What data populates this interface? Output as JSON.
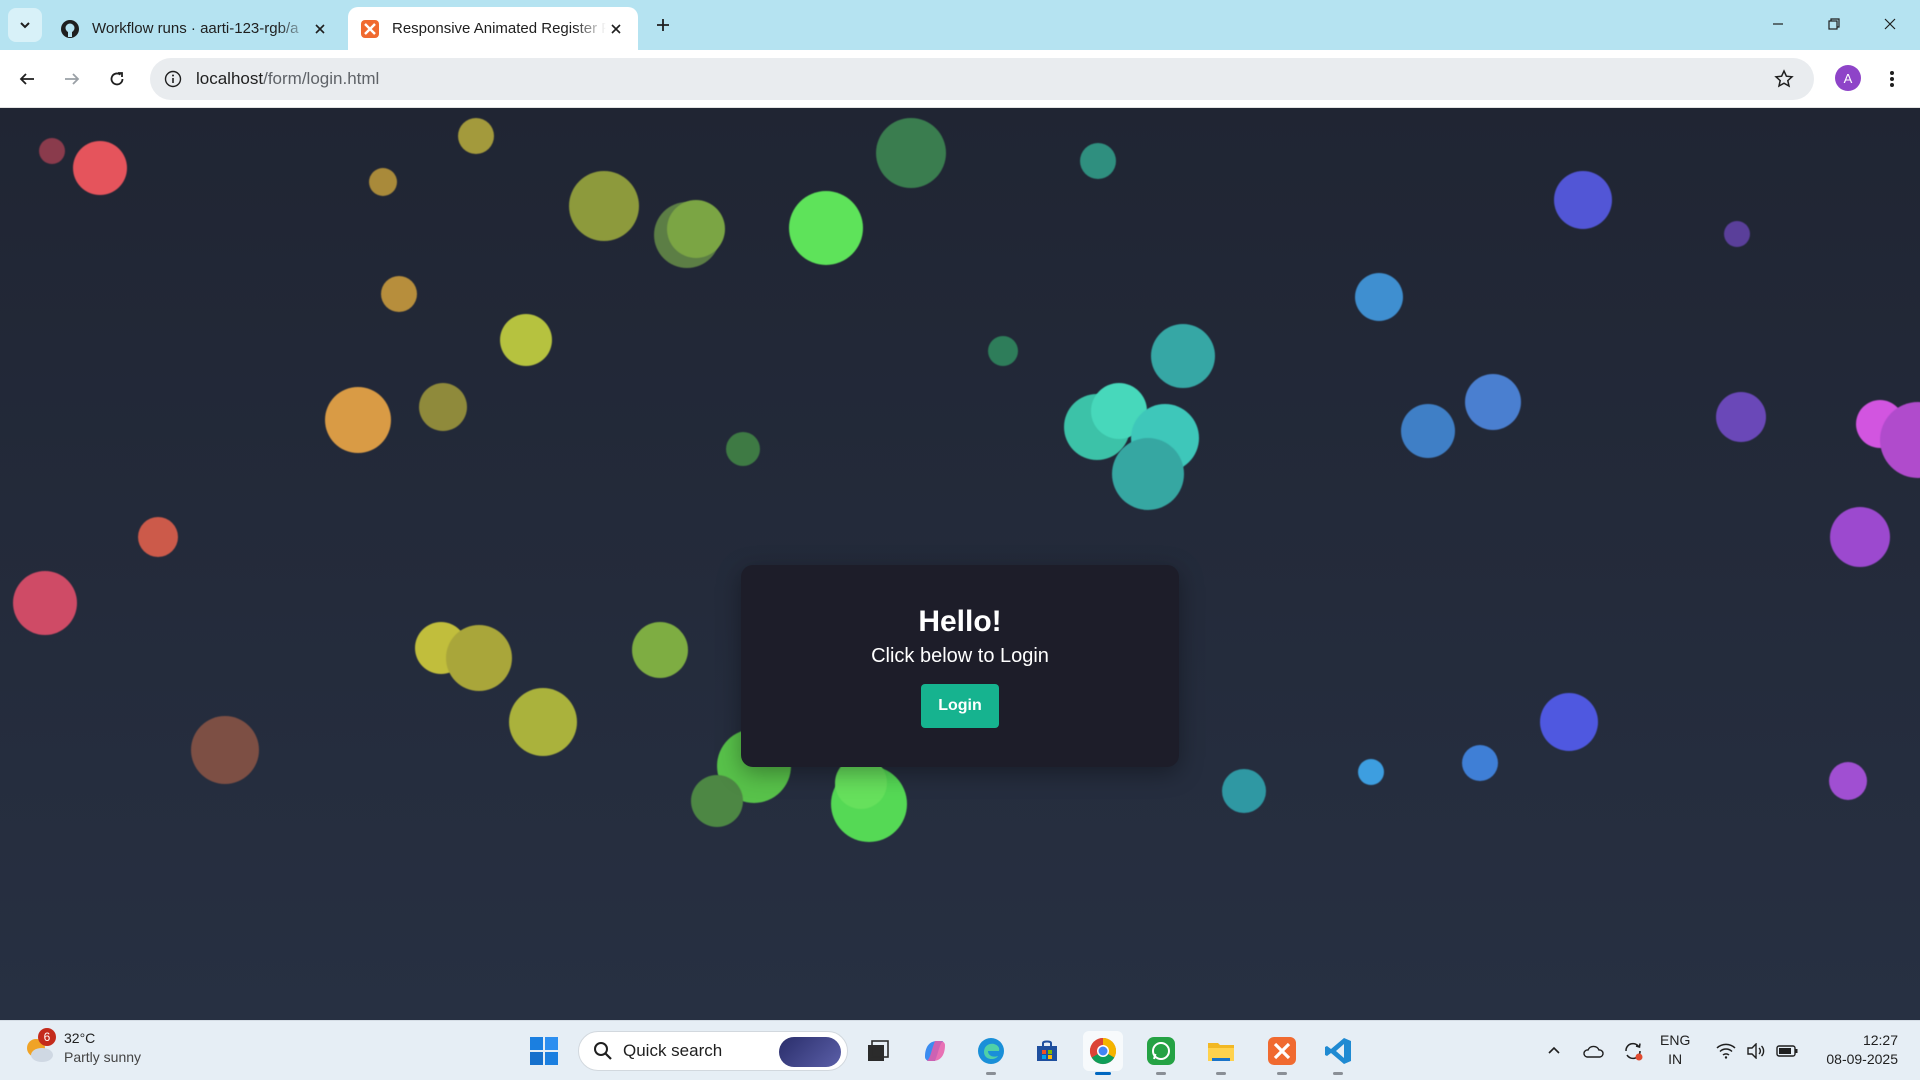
{
  "browser": {
    "tabs": [
      {
        "title": "Workflow runs · aarti-123-rgb/a",
        "icon": "github-icon",
        "active": false
      },
      {
        "title": "Responsive Animated Register F",
        "icon": "xampp-icon",
        "active": true
      }
    ],
    "url_host": "localhost",
    "url_path": "/form/login.html",
    "profile_initial": "A"
  },
  "page": {
    "heading": "Hello!",
    "subheading": "Click below to Login",
    "login_label": "Login",
    "accent_color": "#16b38f"
  },
  "taskbar": {
    "weather_temp": "32°C",
    "weather_condition": "Partly sunny",
    "weather_badge": "6",
    "search_placeholder": "Quick search",
    "apps": [
      "windows-start-icon",
      "task-view-icon",
      "copilot-icon",
      "edge-icon",
      "store-icon",
      "chrome-icon",
      "whatsapp-icon",
      "file-explorer-icon",
      "xampp-icon",
      "vscode-icon"
    ],
    "lang_line1": "ENG",
    "lang_line2": "IN",
    "time": "12:27",
    "date": "08-09-2025"
  }
}
